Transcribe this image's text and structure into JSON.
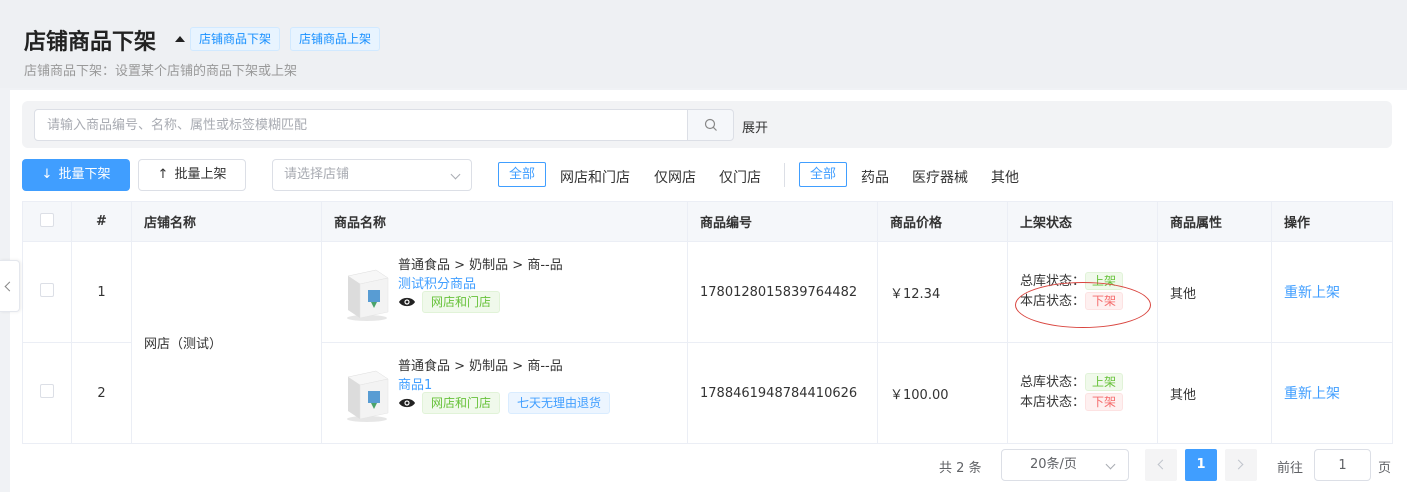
{
  "header": {
    "title": "店铺商品下架",
    "tags": [
      "店铺商品下架",
      "店铺商品上架"
    ],
    "subtitle": "店铺商品下架：设置某个店铺的商品下架或上架"
  },
  "search": {
    "placeholder": "请输入商品编号、名称、属性或标签模糊匹配",
    "value": "",
    "expand_label": "展开"
  },
  "toolbar": {
    "batch_down_label": "批量下架",
    "batch_up_label": "批量上架",
    "store_select_placeholder": "请选择店铺",
    "channel_filters": [
      "全部",
      "网店和门店",
      "仅网店",
      "仅门店"
    ],
    "channel_selected": "全部",
    "category_filters": [
      "全部",
      "药品",
      "医疗器械",
      "其他"
    ],
    "category_selected": "全部"
  },
  "table": {
    "columns": [
      "#",
      "店铺名称",
      "商品名称",
      "商品编号",
      "商品价格",
      "上架状态",
      "商品属性",
      "操作"
    ],
    "store_name": "网店（测试）",
    "rows": [
      {
        "index": "1",
        "category_path": "普通食品 > 奶制品 > 商--品",
        "product_name": "测试积分商品",
        "tags": [
          "网店和门店"
        ],
        "code": "1780128015839764482",
        "price": "￥12.34",
        "warehouse_status_label": "总库状态：",
        "warehouse_status": "上架",
        "store_status_label": "本店状态：",
        "store_status": "下架",
        "attribute": "其他",
        "action": "重新上架"
      },
      {
        "index": "2",
        "category_path": "普通食品 > 奶制品 > 商--品",
        "product_name": "商品1",
        "tags": [
          "网店和门店",
          "七天无理由退货"
        ],
        "code": "1788461948784410626",
        "price": "￥100.00",
        "warehouse_status_label": "总库状态：",
        "warehouse_status": "上架",
        "store_status_label": "本店状态：",
        "store_status": "下架",
        "attribute": "其他",
        "action": "重新上架"
      }
    ]
  },
  "pagination": {
    "total_label": "共 2 条",
    "page_size": "20条/页",
    "current_page": "1",
    "goto_label": "前往",
    "goto_value": "1",
    "page_suffix": "页"
  },
  "icons": {
    "search": "search-icon",
    "eye": "eye-icon",
    "arrow_down": "arrow-down-icon",
    "arrow_up": "arrow-up-icon"
  },
  "colors": {
    "primary": "#409eff",
    "success": "#67c23a",
    "danger": "#f56c6c",
    "annotation": "#d9453f"
  }
}
